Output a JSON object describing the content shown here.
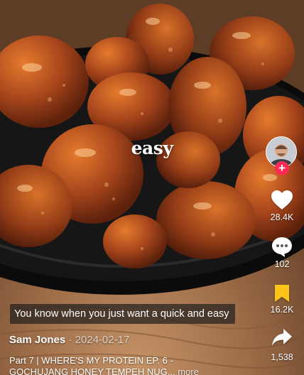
{
  "video": {
    "overlay_text": "easy",
    "caption_box": "You know when you just want a quick and easy"
  },
  "author": {
    "name": "Sam Jones",
    "separator": " · ",
    "date": "2024-02-17",
    "follow_symbol": "+"
  },
  "description": {
    "line1": "Part 7 | WHERE'S MY PROTEIN EP. 6 -",
    "line2": "GOCHUJANG HONEY TEMPEH NUG...",
    "more": "more"
  },
  "actions": {
    "likes": "28.4K",
    "comments": "102",
    "saves": "16.2K",
    "shares": "1,538"
  },
  "colors": {
    "follow": "#fe2c55",
    "save": "#fcc419",
    "icon": "#ffffff"
  },
  "icons": {
    "like": "heart-icon",
    "comment": "comment-bubble-icon",
    "save": "bookmark-icon",
    "share": "share-arrow-icon"
  }
}
